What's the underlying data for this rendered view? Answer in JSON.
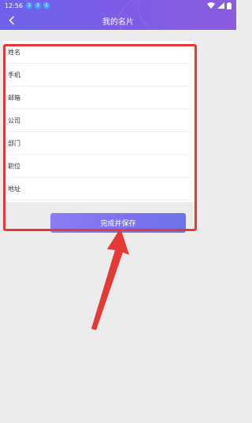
{
  "status_bar": {
    "time": "12:56",
    "notifications": [
      "1",
      "1",
      "1"
    ]
  },
  "header": {
    "title": "我的名片",
    "back_icon": "chevron-left-icon"
  },
  "form": {
    "fields": [
      {
        "label": "姓名",
        "value": "",
        "placeholder": ""
      },
      {
        "label": "手机",
        "value": "",
        "placeholder": ""
      },
      {
        "label": "邮箱",
        "value": "",
        "placeholder": ""
      },
      {
        "label": "公司",
        "value": "",
        "placeholder": ""
      },
      {
        "label": "部门",
        "value": "",
        "placeholder": ""
      },
      {
        "label": "职位",
        "value": "",
        "placeholder": ""
      },
      {
        "label": "地址",
        "value": "",
        "placeholder": ""
      }
    ]
  },
  "actions": {
    "save_label": "完成并保存"
  },
  "colors": {
    "header_start": "#6c63ea",
    "header_end": "#8a5bdc",
    "button": "#7a72ee",
    "annotation": "#e53935"
  }
}
